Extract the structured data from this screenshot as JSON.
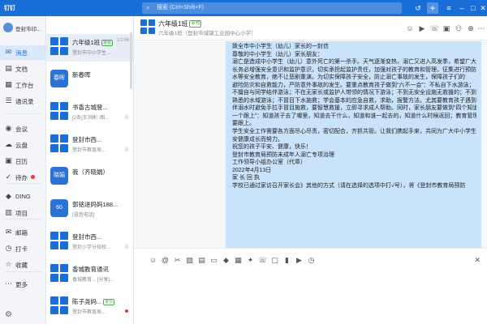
{
  "app": {
    "name": "钉钉"
  },
  "search": {
    "placeholder": "搜索 (Ctrl+Shift+F)"
  },
  "titlebar": {
    "icons": [
      "history-icon",
      "add-icon",
      "menu-icon",
      "minimize-icon",
      "maximize-icon",
      "close-icon"
    ],
    "add_label": "+"
  },
  "user": {
    "name": "登封市印..."
  },
  "nav": [
    {
      "label": "消息",
      "icon": "message-icon",
      "glyph": "✉",
      "active": true
    },
    {
      "label": "文档",
      "icon": "document-icon",
      "glyph": "▤"
    },
    {
      "label": "工作台",
      "icon": "workbench-icon",
      "glyph": "▦"
    },
    {
      "label": "通讯录",
      "icon": "contacts-icon",
      "glyph": "☰"
    },
    {
      "label": "会议",
      "icon": "meeting-icon",
      "glyph": "◉"
    },
    {
      "label": "云盘",
      "icon": "cloud-icon",
      "glyph": "☁"
    },
    {
      "label": "日历",
      "icon": "calendar-icon",
      "glyph": "▣"
    },
    {
      "label": "待办",
      "icon": "todo-icon",
      "glyph": "✓",
      "dot": true
    },
    {
      "label": "DING",
      "icon": "ding-icon",
      "glyph": "◆"
    },
    {
      "label": "项目",
      "icon": "project-icon",
      "glyph": "▥"
    },
    {
      "label": "邮箱",
      "icon": "mail-icon",
      "glyph": "✉"
    },
    {
      "label": "打卡",
      "icon": "checkin-icon",
      "glyph": "◷"
    },
    {
      "label": "收藏",
      "icon": "favorite-icon",
      "glyph": "☆"
    },
    {
      "label": "更多",
      "icon": "more-icon",
      "glyph": "⋯"
    }
  ],
  "conversations": [
    {
      "title": "六年级1班",
      "tag": "家校",
      "snippet": "登封市中小学生...",
      "time": "10:56",
      "avatar": "grid",
      "active": true
    },
    {
      "title": "新春晖",
      "snippet": "",
      "time": "",
      "avatar": "solid",
      "avatar_text": "春晖"
    },
    {
      "title": "书香古城登...",
      "snippet": "[2条]王洪彬: 图...",
      "time": "",
      "avatar": "grid",
      "flag": "Ⓐ"
    },
    {
      "title": "登封市西...",
      "snippet": "登封市教育局...",
      "time": "",
      "avatar": "grid",
      "flag": "Ⓐ"
    },
    {
      "title": "我（齐晓娟）",
      "snippet": "",
      "time": "",
      "avatar": "solid",
      "avatar_text": "晓娟"
    },
    {
      "title": "郭铭进妈妈188...",
      "snippet": "[语音电话]",
      "time": "",
      "avatar": "solid",
      "avatar_text": "60"
    },
    {
      "title": "登封市西...",
      "snippet": "登封小学分校校...",
      "time": "",
      "avatar": "grid",
      "flag": "Ⓐ"
    },
    {
      "title": "香城教育通讯",
      "snippet": "香城教育... [分享]...",
      "time": "",
      "avatar": "grid"
    },
    {
      "title": "陈子尧妈...",
      "tag": "家长",
      "snippet": "登封市教育局...",
      "time": "",
      "avatar": "grid",
      "dot": true
    }
  ],
  "chat": {
    "title": "六年级1班",
    "tag": "家校",
    "subtitle": "六年级1班（登封市城镇工业园中心小学）",
    "icons": [
      "contact-icon",
      "video-icon",
      "phone-icon",
      "calendar-icon",
      "group-icon",
      "add-person-icon",
      "more-icon"
    ],
    "message_lines": [
      {
        "text": "致全市中小学生（幼儿）家长的一封信"
      },
      {
        "text": "尊敬的中小学生（幼儿）家长朋友："
      },
      {
        "text": "    溺亡是造成中小学生（幼儿）意外死亡的第一杀手。天气逐渐变热，溺亡又进入高发季，希望广大家"
      },
      {
        "text": "长务必增强安全意识和监护意识，切实承担起监护责任，加强对孩子的教育和管理，征集进行预防溺"
      },
      {
        "text": "水等安全教育，绝不让悲剧重演。为切实保障孩子安全，防止溺亡事故的发生，保障孩子们的"
      },
      {
        "text": "避险防灾和自救能力，严防意外事故的发生。要重点教育孩子做到“六不一会”：不私自下水游泳；"
      },
      {
        "text": "不擅自与同学结伴游泳；不在无家长或监护人带领的情况下游泳；不到无安全设施无救援的；不到不"
      },
      {
        "text": "熟悉的水域游泳；不冒目下水施救；学会基本的应急自救，求助，报警方法。尤其要教育孩子遇到同"
      },
      {
        "text": "伴溺水时避免手拉手冒目施救，要智慧救援，立即寻求成人帮助。同时，家长朋友要做到“四个知道"
      },
      {
        "text": "一个跟上”：知道孩子去了哪里，知道去干什么，知道和谁一起去的，知道什么时候返回；教育管理"
      },
      {
        "text": "要跟上。"
      },
      {
        "text": "    学生安全工作需要各方面尽心尽责，密切配合，齐抓共管。让我们携起手来，共同为广大中小学生平"
      },
      {
        "text": "安健康成长而努力。"
      },
      {
        "text": "    祝您的孩子平安、健康，快乐！"
      },
      {
        "text": "                登封市教育局预防未成年人溺亡专项治理"
      },
      {
        "text": "                工作领导小组办公室（代章）"
      },
      {
        "text": "                2022年4月13日"
      },
      {
        "text": "        家 长 回 执"
      },
      {
        "text": "    学校已通过家访召开家长会》其他的方式（请在选择的选项中打√号），将《登封市教育局预防"
      }
    ]
  },
  "toolbar": {
    "icons": [
      "emoji-icon",
      "mention-icon",
      "screenshot-icon",
      "image-icon",
      "file-icon",
      "folder-icon",
      "ding-icon",
      "task-icon",
      "sticker-icon",
      "phone-icon",
      "contact-card-icon",
      "hongbao-icon",
      "live-icon",
      "history-icon",
      "more-icon"
    ]
  }
}
